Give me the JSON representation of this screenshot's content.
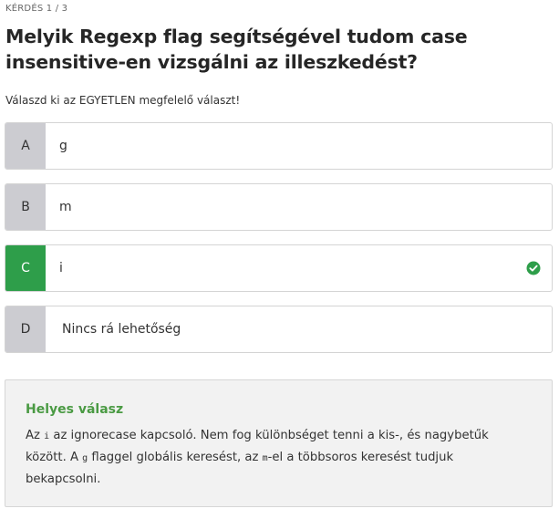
{
  "quiz": {
    "counter": "KÉRDÉS 1 / 3",
    "question": "Melyik Regexp flag segítségével tudom case insensitive-en vizsgálni az illeszkedést?",
    "instruction": "Válaszd ki az EGYETLEN megfelelő választ!"
  },
  "options": [
    {
      "letter": "A",
      "text": "g"
    },
    {
      "letter": "B",
      "text": "m"
    },
    {
      "letter": "C",
      "text": "i",
      "status": "correct"
    },
    {
      "letter": "D",
      "text": "Nincs rá lehetőség"
    }
  ],
  "colors": {
    "correct": "#2e9e4a",
    "letter_bg": "#ccccd1",
    "explanation_title": "#4a9a43"
  },
  "icons": {
    "correct_marker": "check-circle-icon"
  },
  "explanation": {
    "title": "Helyes válasz",
    "p1": "Az ",
    "code1": "i",
    "p2": " az ignorecase kapcsoló. Nem fog különbséget tenni a kis-, és nagybetűk között. A ",
    "code2": "g",
    "p3": " flaggel globális keresést, az ",
    "code3": "m",
    "p4": "-el a többsoros keresést tudjuk bekapcsolni."
  }
}
